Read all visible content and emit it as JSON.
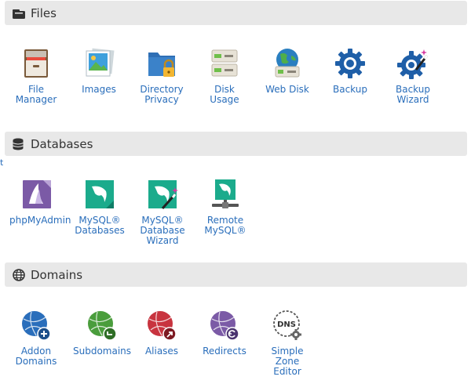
{
  "sections": {
    "files": {
      "title": "Files",
      "icon": "folder-stack-icon",
      "items": [
        {
          "label": "File\nManager",
          "icon": "file-cabinet-icon"
        },
        {
          "label": "Images",
          "icon": "photo-stack-icon"
        },
        {
          "label": "Directory\nPrivacy",
          "icon": "folder-lock-icon"
        },
        {
          "label": "Disk Usage",
          "icon": "hard-drive-usage-icon"
        },
        {
          "label": "Web Disk",
          "icon": "globe-drive-icon"
        },
        {
          "label": "Backup",
          "icon": "backup-gear-icon"
        },
        {
          "label": "Backup\nWizard",
          "icon": "backup-wizard-icon"
        }
      ]
    },
    "databases": {
      "title": "Databases",
      "icon": "database-icon",
      "items": [
        {
          "label": "phpMyAdmin",
          "icon": "phpmyadmin-sail-icon"
        },
        {
          "label": "MySQL®\nDatabases",
          "icon": "mysql-dolphin-icon"
        },
        {
          "label": "MySQL®\nDatabase\nWizard",
          "icon": "mysql-wizard-icon"
        },
        {
          "label": "Remote\nMySQL®",
          "icon": "remote-mysql-icon"
        }
      ]
    },
    "domains": {
      "title": "Domains",
      "icon": "globe-icon",
      "items": [
        {
          "label": "Addon\nDomains",
          "icon": "addon-domain-globe-icon"
        },
        {
          "label": "Subdomains",
          "icon": "subdomain-globe-icon"
        },
        {
          "label": "Aliases",
          "icon": "alias-globe-icon"
        },
        {
          "label": "Redirects",
          "icon": "redirect-globe-icon"
        },
        {
          "label": "Simple\nZone\nEditor",
          "icon": "dns-zone-icon"
        }
      ]
    }
  },
  "colors": {
    "link": "#2a6ebb",
    "header_bg": "#e8e8e8",
    "header_text": "#333333",
    "blue": "#1f5fa8",
    "green": "#4a9d3c",
    "red": "#c8343f",
    "purple": "#7b5aa6",
    "teal": "#1bab8c"
  }
}
